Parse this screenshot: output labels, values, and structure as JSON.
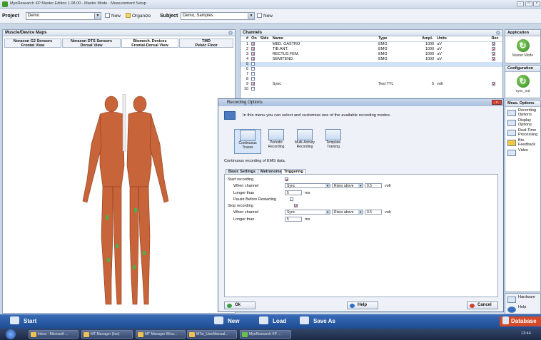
{
  "window": {
    "title": "MyoResearch XP Master Edition 1.08.00 - Master Mode - Measurement Setup"
  },
  "project": {
    "label": "Project",
    "value": "Demo",
    "new_label": "New",
    "organize_label": "Organize"
  },
  "subject": {
    "label": "Subject",
    "value": "Demo, Samples",
    "new_label": "New"
  },
  "muscle_panel": {
    "title": "Muscle/Device Maps",
    "tabs": [
      {
        "top": "Noraxon G2 Sensors",
        "bottom": "Frontal View"
      },
      {
        "top": "Noraxon DTS Sensors",
        "bottom": "Dorsal View"
      },
      {
        "top": "Biomech. Devices",
        "bottom": "Frontal-Dorsal View"
      },
      {
        "top": "TMD",
        "bottom": "Pelvic Floor"
      }
    ]
  },
  "channels": {
    "title": "Channels",
    "columns": [
      "#",
      "On",
      "Side",
      "Name",
      "Type",
      "Ampl.",
      "Units",
      "Rec"
    ],
    "rows": [
      {
        "n": "1",
        "on": true,
        "name": "MED. GASTRO",
        "type": "EMG",
        "ampl": "1000",
        "units": "uV",
        "rec": true
      },
      {
        "n": "2",
        "on": true,
        "name": "TIB.ANT.",
        "type": "EMG",
        "ampl": "1000",
        "units": "uV",
        "rec": true
      },
      {
        "n": "3",
        "on": true,
        "name": "RECTUS FEM.",
        "type": "EMG",
        "ampl": "1000",
        "units": "uV",
        "rec": true
      },
      {
        "n": "4",
        "on": true,
        "name": "SEMITEND.",
        "type": "EMG",
        "ampl": "1000",
        "units": "uV",
        "rec": true
      },
      {
        "n": "5",
        "on": false,
        "name": "",
        "type": "",
        "ampl": "",
        "units": "",
        "rec": false
      },
      {
        "n": "6",
        "on": false,
        "name": "",
        "type": "",
        "ampl": "",
        "units": "",
        "rec": false
      },
      {
        "n": "7",
        "on": false,
        "name": "",
        "type": "",
        "ampl": "",
        "units": "",
        "rec": false
      },
      {
        "n": "8",
        "on": false,
        "name": "",
        "type": "",
        "ampl": "",
        "units": "",
        "rec": false
      },
      {
        "n": "9",
        "on": true,
        "name": "Sync",
        "type": "Test TTL",
        "ampl": "5",
        "units": "volt",
        "rec": true
      },
      {
        "n": "10",
        "on": false,
        "name": "",
        "type": "",
        "ampl": "",
        "units": "",
        "rec": false
      }
    ]
  },
  "right": {
    "application": "Application",
    "master_mode": "Master Mode",
    "configuration": "Configuration",
    "config_name": "sync_out",
    "meas_options": "Meas. Options",
    "options": [
      "Recording Options",
      "Display Options",
      "Real-Time Processing",
      "Bio-Feedback",
      "Video"
    ],
    "hardware": "Hardware",
    "help": "Help"
  },
  "dialog": {
    "title": "Recording Options",
    "intro": "In this menu you can select and customize one of the available recording modes.",
    "modes": [
      "Continuous Traces",
      "Periodic Recording",
      "Multi-Activity Recording",
      "Template Training"
    ],
    "mode_desc": "Continuous recording of EMG data.",
    "tabs": [
      "Basic Settings",
      "Metronome",
      "Triggering"
    ],
    "start_recording": "Start recording",
    "when_channel": "When channel",
    "channel_value": "Sync",
    "condition": "Rises above",
    "threshold": "0.5",
    "unit": "volt",
    "longer_than": "Longer than",
    "duration": "5",
    "ms": "ms",
    "pause": "Pause Before Restarting",
    "stop_recording": "Stop recording",
    "ok": "Ok",
    "help": "Help",
    "cancel": "Cancel"
  },
  "actions": {
    "start": "Start",
    "new": "New",
    "load": "Load",
    "save_as": "Save As",
    "database": "Database"
  },
  "taskbar": {
    "items": [
      "Inbox - Microsoft ...",
      "MT Manager (live)",
      "MT Manager Wiza...",
      "MTw_UserManual...",
      "MyoResearch XP ..."
    ],
    "time": "13:44"
  }
}
